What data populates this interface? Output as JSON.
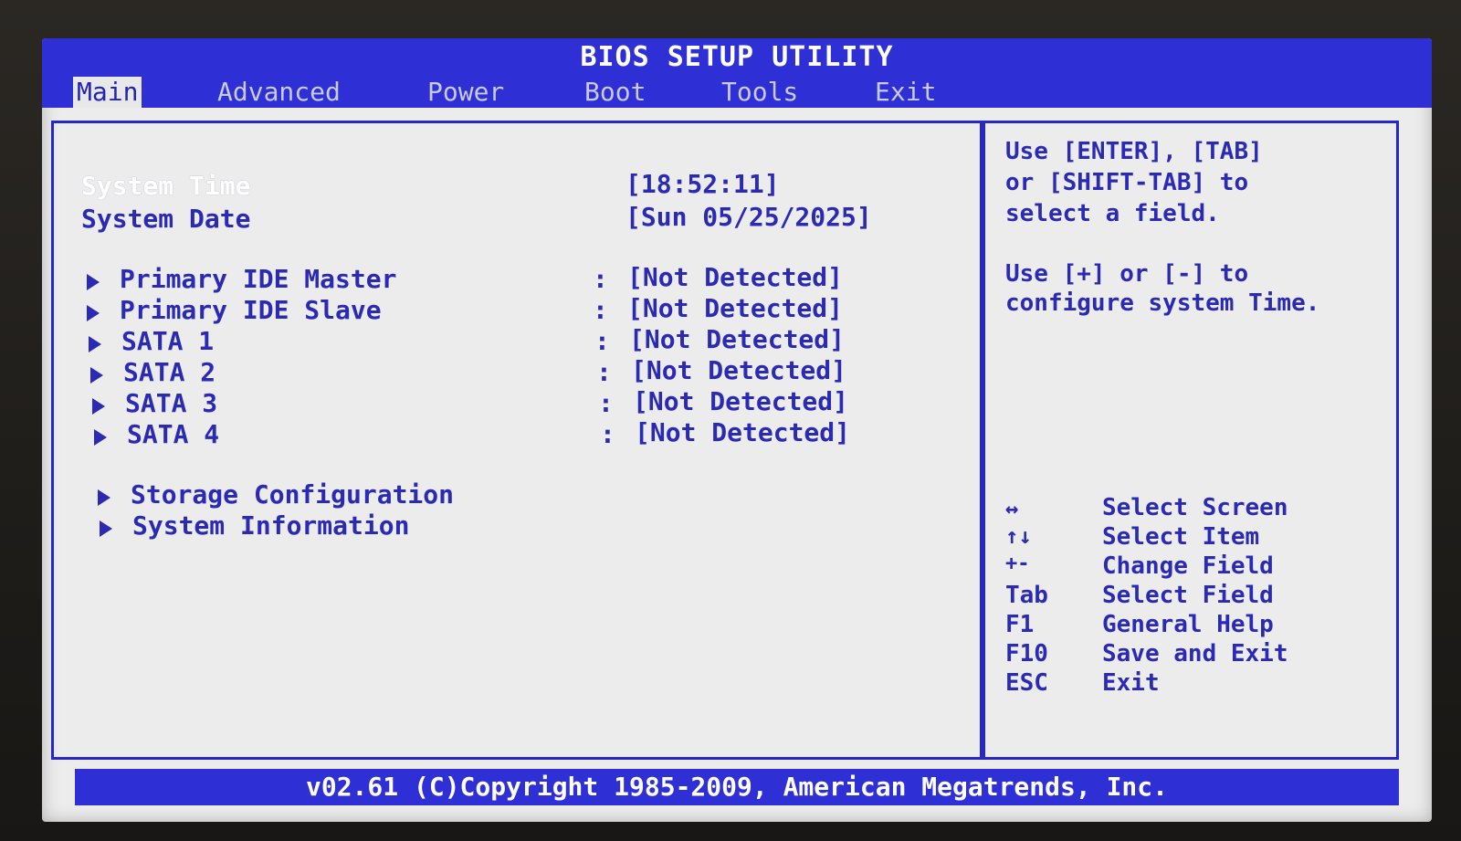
{
  "window": {
    "title": "BIOS SETUP UTILITY"
  },
  "menu": {
    "tabs": [
      {
        "label": "Main",
        "active": true
      },
      {
        "label": "Advanced"
      },
      {
        "label": "Power"
      },
      {
        "label": "Boot"
      },
      {
        "label": "Tools"
      },
      {
        "label": "Exit"
      }
    ]
  },
  "main": {
    "system_time": {
      "label": "System Time",
      "value": "[18:52:11]"
    },
    "system_date": {
      "label": "System Date",
      "value": "[Sun 05/25/2025]"
    },
    "devices": [
      {
        "label": "Primary IDE Master",
        "sep": ":",
        "value": "[Not Detected]"
      },
      {
        "label": "Primary IDE Slave",
        "sep": ":",
        "value": "[Not Detected]"
      },
      {
        "label": "SATA 1",
        "sep": ":",
        "value": "[Not Detected]"
      },
      {
        "label": "SATA 2",
        "sep": ":",
        "value": "[Not Detected]"
      },
      {
        "label": "SATA 3",
        "sep": ":",
        "value": "[Not Detected]"
      },
      {
        "label": "SATA 4",
        "sep": ":",
        "value": "[Not Detected]"
      }
    ],
    "submenus": [
      {
        "label": "Storage Configuration"
      },
      {
        "label": "System Information"
      }
    ]
  },
  "help": {
    "lines": [
      "Use [ENTER], [TAB]",
      "or [SHIFT-TAB] to",
      "select a field.",
      "",
      "Use [+] or [-] to",
      "configure system Time."
    ],
    "keys": [
      {
        "key": "↔",
        "desc": "Select Screen"
      },
      {
        "key": "↑↓",
        "desc": "Select Item"
      },
      {
        "key": "+-",
        "desc": "Change Field"
      },
      {
        "key": "Tab",
        "desc": "Select Field"
      },
      {
        "key": "F1",
        "desc": "General Help"
      },
      {
        "key": "F10",
        "desc": "Save and Exit"
      },
      {
        "key": "ESC",
        "desc": "Exit"
      }
    ]
  },
  "footer": {
    "text": "v02.61 (C)Copyright 1985-2009, American Megatrends, Inc."
  },
  "colors": {
    "accent_blue": "#2f2fd6",
    "text_blue": "#2a2ab4",
    "background": "#ececec",
    "highlight": "#ffffff"
  }
}
